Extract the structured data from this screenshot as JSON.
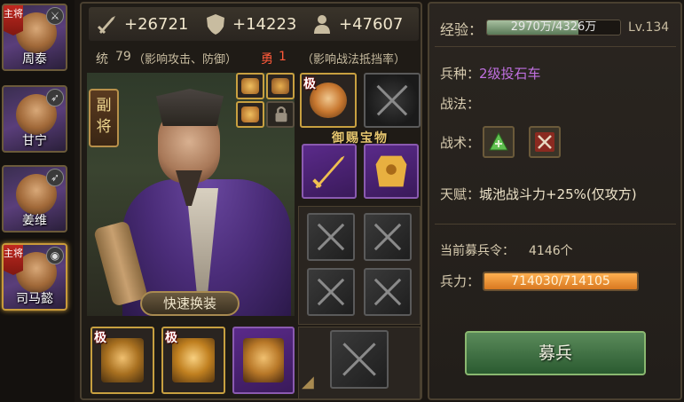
{
  "roster": [
    {
      "name": "周泰",
      "main": true,
      "tag": "主将",
      "weapon_icon": "sword-icon"
    },
    {
      "name": "甘宁",
      "main": false,
      "tag": "",
      "weapon_icon": "bow-icon"
    },
    {
      "name": "姜维",
      "main": false,
      "tag": "",
      "weapon_icon": "bow-icon"
    },
    {
      "name": "司马懿",
      "main": true,
      "tag": "主将",
      "weapon_icon": "cannon-icon",
      "selected": true
    }
  ],
  "stats": {
    "attack": "+26721",
    "defense": "+14223",
    "troops": "+47607"
  },
  "attributes": {
    "command_label": "统",
    "command_value": "79",
    "command_note": "（影响攻击、防御）",
    "brave_label": "勇",
    "brave_value": "1",
    "brave_note": "（影响战法抵挡率）"
  },
  "hero": {
    "role_badge": "副\n将",
    "quick_swap": "快速换装"
  },
  "treasure_title": "御赐宝物",
  "slot_tag": "极",
  "info": {
    "exp_label": "经验：",
    "exp_text": "2970万/4326万",
    "exp_fraction": 0.687,
    "level": "Lv.134",
    "unit_label": "兵种：",
    "unit_value": "2级投石车",
    "skill_label": "战法：",
    "tactic_label": "战术：",
    "talent_label": "天赋：",
    "talent_value": "城池战斗力+25%(仅攻方)",
    "recruit_label": "当前募兵令：",
    "recruit_value": "4146个",
    "troop_label": "兵力：",
    "troop_text": "714030/714105",
    "troop_fraction": 0.9999,
    "recruit_button": "募兵"
  },
  "colors": {
    "unit_value": "#c070e0",
    "talent_value": "#f0e6cc",
    "brave_value": "#ff5a3a",
    "purple_slot": "#5a2a8a",
    "recruit_green": "#2a5a30"
  }
}
